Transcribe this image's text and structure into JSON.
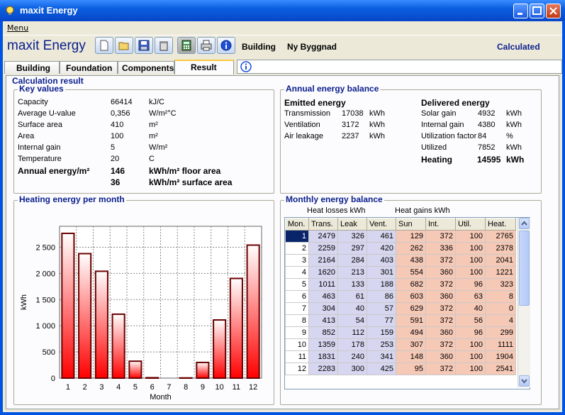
{
  "window": {
    "title": "maxit Energy"
  },
  "menu": {
    "items": [
      "Menu"
    ]
  },
  "brand": "maxit Energy",
  "header": {
    "building_label": "Building",
    "building_name": "Ny Byggnad",
    "status": "Calculated"
  },
  "toolbar": {
    "icons": [
      "new-icon",
      "open-icon",
      "save-icon",
      "delete-icon",
      "calculator-icon",
      "print-icon",
      "info-icon"
    ]
  },
  "tabs": [
    "Building",
    "Foundation",
    "Components",
    "Result"
  ],
  "result": {
    "title": "Calculation result"
  },
  "key_values": {
    "title": "Key values",
    "rows": [
      {
        "label": "Capacity",
        "value": "66414",
        "unit": "kJ/C"
      },
      {
        "label": "Average U-value",
        "value": "0,356",
        "unit": "W/m²°C"
      },
      {
        "label": "Surface area",
        "value": "410",
        "unit": "m²"
      },
      {
        "label": "Area",
        "value": "100",
        "unit": "m²"
      },
      {
        "label": "Internal gain",
        "value": "5",
        "unit": "W/m²"
      },
      {
        "label": "Temperature",
        "value": "20",
        "unit": "C"
      }
    ],
    "annual_label": "Annual energy/m²",
    "annual_value_1": "146",
    "annual_unit_1": "kWh/m² floor area",
    "annual_value_2": "36",
    "annual_unit_2": "kWh/m² surface area"
  },
  "annual_balance": {
    "title": "Annual energy balance",
    "emitted_title": "Emitted energy",
    "emitted": [
      {
        "label": "Transmission",
        "value": "17038",
        "unit": "kWh"
      },
      {
        "label": "Ventilation",
        "value": "3172",
        "unit": "kWh"
      },
      {
        "label": "Air leakage",
        "value": "2237",
        "unit": "kWh"
      }
    ],
    "delivered_title": "Delivered energy",
    "delivered": [
      {
        "label": "Solar gain",
        "value": "4932",
        "unit": "kWh"
      },
      {
        "label": "Internal gain",
        "value": "4380",
        "unit": "kWh"
      },
      {
        "label": "Utilization factor",
        "value": "84",
        "unit": "%"
      },
      {
        "label": "Utilized",
        "value": "7852",
        "unit": "kWh"
      }
    ],
    "heating_label": "Heating",
    "heating_value": "14595",
    "heating_unit": "kWh"
  },
  "heating_chart": {
    "title": "Heating energy per month"
  },
  "chart_data": {
    "type": "bar",
    "categories": [
      "1",
      "2",
      "3",
      "4",
      "5",
      "6",
      "7",
      "8",
      "9",
      "10",
      "11",
      "12"
    ],
    "values": [
      2765,
      2378,
      2041,
      1221,
      323,
      8,
      0,
      4,
      299,
      1111,
      1904,
      2541
    ],
    "xlabel": "Month",
    "ylabel": "kWh",
    "ylim": [
      0,
      2900
    ],
    "yticks": [
      "0",
      "500",
      "1 000",
      "1 500",
      "2 000",
      "2 500"
    ],
    "yticks_values": [
      0,
      500,
      1000,
      1500,
      2000,
      2500
    ],
    "grid": true,
    "colors": {
      "bar_top": "#ffffff",
      "bar_bottom": "#ff0000",
      "bar_edge": "#6b0000"
    }
  },
  "monthly": {
    "title": "Monthly energy balance",
    "losses_label": "Heat losses kWh",
    "gains_label": "Heat gains kWh",
    "columns": [
      "Mon.",
      "Trans.",
      "Leak",
      "Vent.",
      "Sun",
      "Int.",
      "Util.",
      "Heat."
    ],
    "rows": [
      [
        "1",
        "2479",
        "326",
        "461",
        "129",
        "372",
        "100",
        "2765"
      ],
      [
        "2",
        "2259",
        "297",
        "420",
        "262",
        "336",
        "100",
        "2378"
      ],
      [
        "3",
        "2164",
        "284",
        "403",
        "438",
        "372",
        "100",
        "2041"
      ],
      [
        "4",
        "1620",
        "213",
        "301",
        "554",
        "360",
        "100",
        "1221"
      ],
      [
        "5",
        "1011",
        "133",
        "188",
        "682",
        "372",
        "96",
        "323"
      ],
      [
        "6",
        "463",
        "61",
        "86",
        "603",
        "360",
        "63",
        "8"
      ],
      [
        "7",
        "304",
        "40",
        "57",
        "629",
        "372",
        "40",
        "0"
      ],
      [
        "8",
        "413",
        "54",
        "77",
        "591",
        "372",
        "56",
        "4"
      ],
      [
        "9",
        "852",
        "112",
        "159",
        "494",
        "360",
        "96",
        "299"
      ],
      [
        "10",
        "1359",
        "178",
        "253",
        "307",
        "372",
        "100",
        "1111"
      ],
      [
        "11",
        "1831",
        "240",
        "341",
        "148",
        "360",
        "100",
        "1904"
      ],
      [
        "12",
        "2283",
        "300",
        "425",
        "95",
        "372",
        "100",
        "2541"
      ]
    ]
  }
}
